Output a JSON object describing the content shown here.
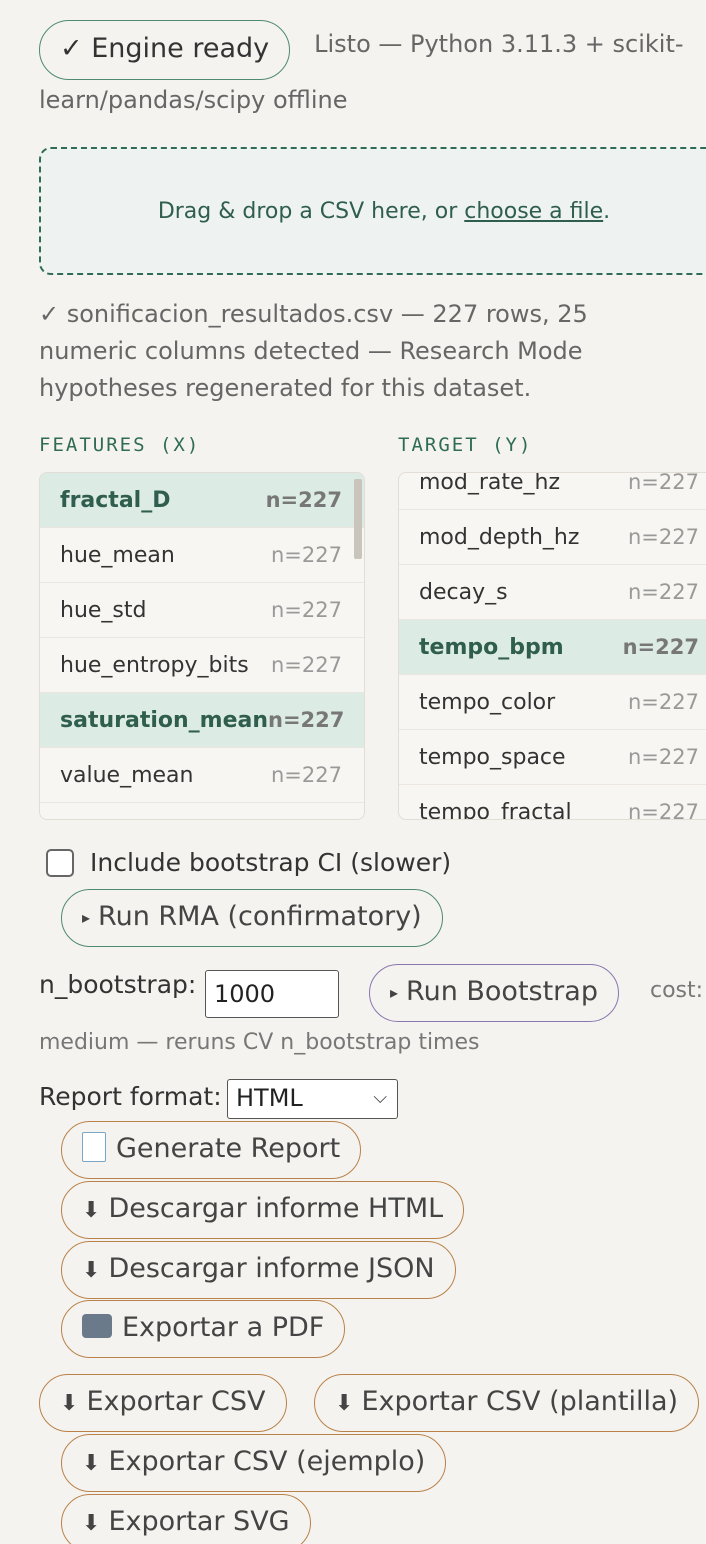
{
  "status": {
    "ready_label": "✓ Engine ready",
    "message_line1": "Listo — Python 3.11.3 + scikit-",
    "message_line2": "learn/pandas/scipy offline"
  },
  "dropzone": {
    "text": "Drag & drop a CSV here, or ",
    "link": "choose a file",
    "after": "."
  },
  "file_info": "✓ sonificacion_resultados.csv — 227 rows, 25 numeric columns detected — Research Mode hypotheses regenerated for this dataset.",
  "features": {
    "label": "FEATURES (X)",
    "items": [
      {
        "name": "fractal_D",
        "n": "n=227",
        "selected": true
      },
      {
        "name": "hue_mean",
        "n": "n=227",
        "selected": false
      },
      {
        "name": "hue_std",
        "n": "n=227",
        "selected": false
      },
      {
        "name": "hue_entropy_bits",
        "n": "n=227",
        "selected": false
      },
      {
        "name": "saturation_mean",
        "n": "n=227",
        "selected": true
      },
      {
        "name": "value_mean",
        "n": "n=227",
        "selected": false
      }
    ]
  },
  "target": {
    "label": "TARGET (Y)",
    "items": [
      {
        "name": "mod_rate_hz",
        "n": "n=227",
        "selected": false
      },
      {
        "name": "mod_depth_hz",
        "n": "n=227",
        "selected": false
      },
      {
        "name": "decay_s",
        "n": "n=227",
        "selected": false
      },
      {
        "name": "tempo_bpm",
        "n": "n=227",
        "selected": true
      },
      {
        "name": "tempo_color",
        "n": "n=227",
        "selected": false
      },
      {
        "name": "tempo_space",
        "n": "n=227",
        "selected": false
      },
      {
        "name": "tempo_fractal",
        "n": "n=227",
        "selected": false
      }
    ]
  },
  "bootstrap_ci": {
    "label": "Include bootstrap CI (slower)",
    "checked": false
  },
  "run_rma": "Run RMA (confirmatory)",
  "n_bootstrap": {
    "label": "n_bootstrap:",
    "value": "1000"
  },
  "run_bootstrap": "Run Bootstrap",
  "cost": {
    "line1": "cost:",
    "line2": "medium — reruns CV n_bootstrap times"
  },
  "report": {
    "label": "Report format:",
    "selected": "HTML"
  },
  "buttons": {
    "generate_report": "Generate Report",
    "download_html": "Descargar informe HTML",
    "download_json": "Descargar informe JSON",
    "export_pdf": "Exportar a PDF",
    "export_csv": "Exportar CSV",
    "export_csv_template": "Exportar CSV (plantilla)",
    "export_csv_example": "Exportar CSV (ejemplo)",
    "export_svg": "Exportar SVG"
  },
  "icons": {
    "play": "▸",
    "download": "⬇",
    "document": "document-icon",
    "printer": "printer-icon"
  }
}
